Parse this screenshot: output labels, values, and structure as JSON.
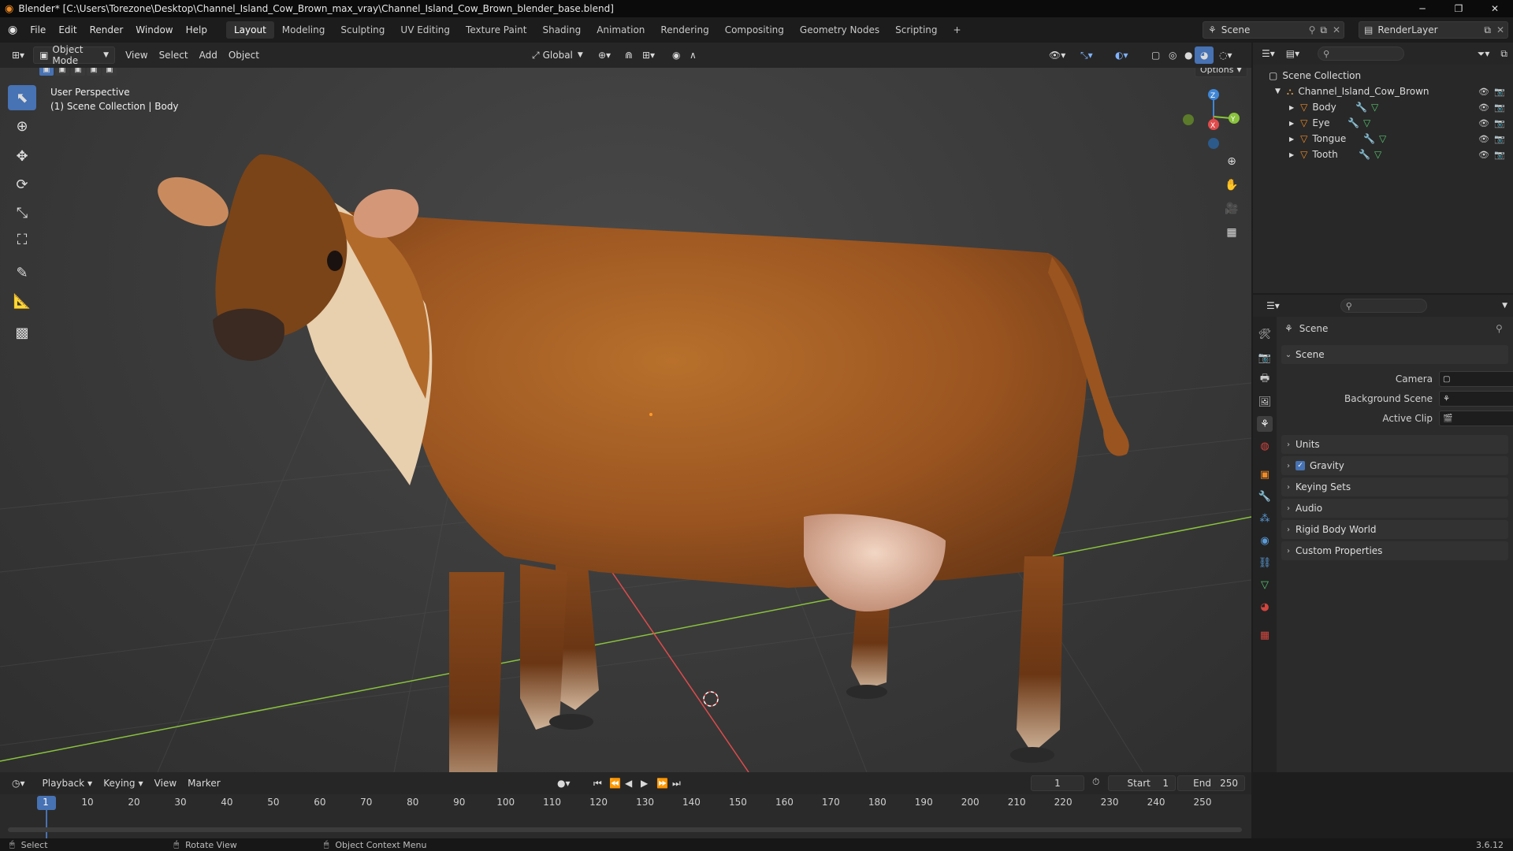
{
  "title_bar": {
    "title": "Blender* [C:\\Users\\Torezone\\Desktop\\Channel_Island_Cow_Brown_max_vray\\Channel_Island_Cow_Brown_blender_base.blend]",
    "minimize": "─",
    "maximize": "❐",
    "close": "✕"
  },
  "menu": {
    "items": [
      "File",
      "Edit",
      "Render",
      "Window",
      "Help"
    ]
  },
  "workspaces": {
    "tabs": [
      "Layout",
      "Modeling",
      "Sculpting",
      "UV Editing",
      "Texture Paint",
      "Shading",
      "Animation",
      "Rendering",
      "Compositing",
      "Geometry Nodes",
      "Scripting"
    ],
    "active": "Layout",
    "add": "+"
  },
  "scene_selector": {
    "scene": "Scene",
    "view_layer": "RenderLayer"
  },
  "viewport_header": {
    "mode": "Object Mode",
    "menus": [
      "View",
      "Select",
      "Add",
      "Object"
    ],
    "transform": "Global",
    "options": "Options"
  },
  "viewport": {
    "perspective": "User Perspective",
    "collection_info": "(1) Scene Collection | Body"
  },
  "gizmo": {
    "x": "X",
    "y": "Y",
    "z": "Z"
  },
  "outliner": {
    "root": "Scene Collection",
    "collection": "Channel_Island_Cow_Brown",
    "objects": [
      "Body",
      "Eye",
      "Tongue",
      "Tooth"
    ]
  },
  "properties": {
    "context": "Scene",
    "section": "Scene",
    "fields": [
      {
        "label": "Camera",
        "value": ""
      },
      {
        "label": "Background Scene",
        "value": ""
      },
      {
        "label": "Active Clip",
        "value": ""
      }
    ],
    "panels": [
      "Units",
      "Gravity",
      "Keying Sets",
      "Audio",
      "Rigid Body World",
      "Custom Properties"
    ]
  },
  "timeline": {
    "menus": [
      "Playback",
      "Keying",
      "View",
      "Marker"
    ],
    "current_frame": "1",
    "start_label": "Start",
    "start": "1",
    "end_label": "End",
    "end": "250",
    "ruler": [
      "1",
      "10",
      "20",
      "30",
      "40",
      "50",
      "60",
      "70",
      "80",
      "90",
      "100",
      "110",
      "120",
      "130",
      "140",
      "150",
      "160",
      "170",
      "180",
      "190",
      "200",
      "210",
      "220",
      "230",
      "240",
      "250"
    ]
  },
  "status_bar": {
    "select": "Select",
    "rotate": "Rotate View",
    "context_menu": "Object Context Menu",
    "version": "3.6.12"
  },
  "colors": {
    "accent": "#4772b3",
    "x_axis": "#e04b4b",
    "y_axis": "#8ac33d",
    "z_axis": "#3f86d6",
    "cow_brown": "#a05a22"
  }
}
